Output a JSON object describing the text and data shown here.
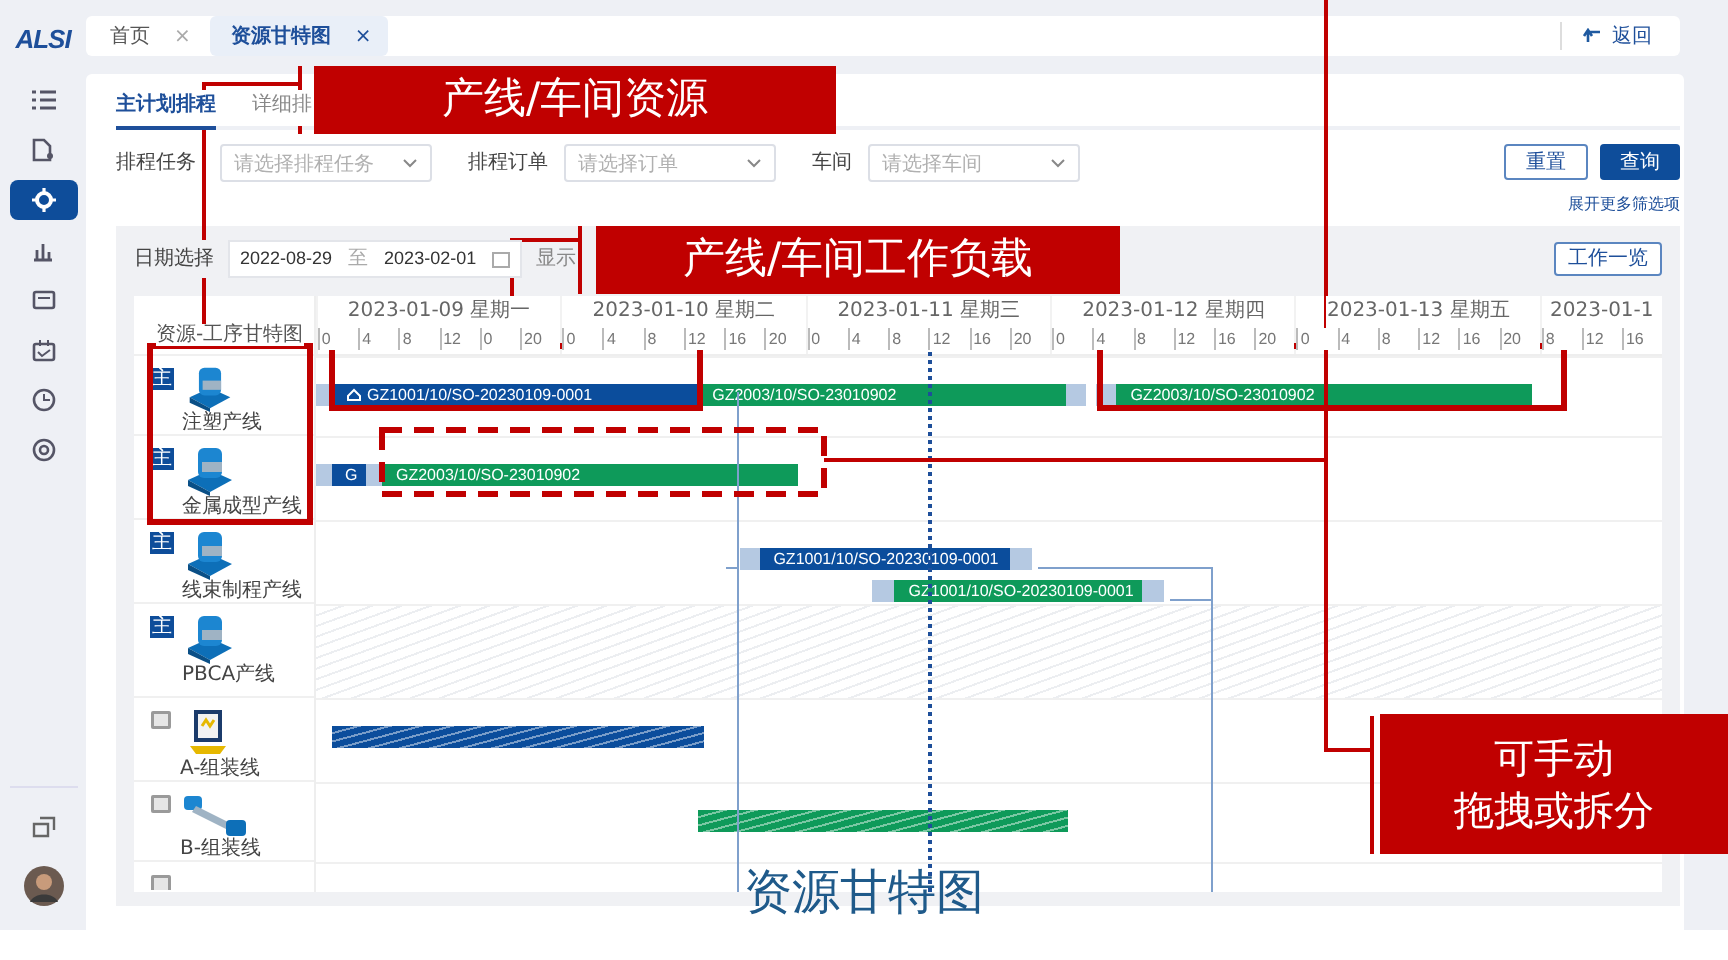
{
  "logo": "ALSI",
  "sidebar": {
    "items": [
      {
        "selected": false
      },
      {
        "selected": false
      },
      {
        "selected": true
      },
      {
        "selected": false
      },
      {
        "selected": false
      },
      {
        "selected": false
      },
      {
        "selected": false
      },
      {
        "selected": false
      }
    ]
  },
  "tabs": [
    {
      "label": "首页",
      "selected": false,
      "close": "×"
    },
    {
      "label": "资源甘特图",
      "selected": true,
      "close": "×"
    }
  ],
  "back": "返回",
  "subtabs": [
    {
      "label": "主计划排程",
      "selected": true
    },
    {
      "label": "详细排",
      "selected": false
    }
  ],
  "filters": [
    {
      "label": "排程任务",
      "placeholder": "请选择排程任务"
    },
    {
      "label": "排程订单",
      "placeholder": "请选择订单"
    },
    {
      "label": "车间",
      "placeholder": "请选择车间"
    }
  ],
  "buttons": [
    {
      "label": "重置",
      "kind": "secondary"
    },
    {
      "label": "查询",
      "kind": "primary"
    }
  ],
  "expand_link": "展开更多筛选项",
  "date_filter": {
    "label": "日期选择",
    "start": "2022-08-29",
    "separator": "至",
    "end": "2023-02-01",
    "display_label": "显示"
  },
  "work_list_button": "工作一览",
  "gantt": {
    "title": "资源-工序甘特图",
    "days": [
      {
        "label": "2023-01-09 星期一",
        "ticks": [
          "0",
          "4",
          "8",
          "12",
          "0",
          "20"
        ]
      },
      {
        "label": "2023-01-10 星期二",
        "ticks": [
          "0",
          "4",
          "8",
          "12",
          "16",
          "20"
        ]
      },
      {
        "label": "2023-01-11 星期三",
        "ticks": [
          "0",
          "4",
          "8",
          "12",
          "16",
          "20"
        ]
      },
      {
        "label": "2023-01-12 星期四",
        "ticks": [
          "0",
          "4",
          "8",
          "12",
          "16",
          "20"
        ]
      },
      {
        "label": "2023-01-13 星期五",
        "ticks": [
          "0",
          "4",
          "8",
          "12",
          "16",
          "20"
        ]
      },
      {
        "label": "2023-01-1",
        "ticks": [
          "8",
          "12",
          "16"
        ]
      }
    ],
    "resources": [
      {
        "name": "注塑产线",
        "kind": "main",
        "badge": "主",
        "unavailable": false,
        "bars": [
          {
            "kind": "setup",
            "color": "#b5c9e2"
          },
          {
            "kind": "task",
            "color": "#0b4d9c",
            "label": "GZ1001/10/SO-20230109-0001",
            "pinned": true
          },
          {
            "kind": "task",
            "color": "#0e9a5a",
            "label": "GZ2003/10/SO-23010902",
            "pinned": false
          },
          {
            "kind": "setup",
            "color": "#b5c9e2"
          },
          {
            "kind": "setup",
            "color": "#b5c9e2"
          },
          {
            "kind": "task",
            "color": "#0e9a5a",
            "label": "GZ2003/10/SO-23010902",
            "pinned": false
          }
        ]
      },
      {
        "name": "金属成型产线",
        "kind": "main",
        "badge": "主",
        "unavailable": false,
        "bars": [
          {
            "kind": "setup",
            "color": "#b5c9e2"
          },
          {
            "kind": "task",
            "color": "#0b4d9c",
            "label": "G",
            "pinned": false
          },
          {
            "kind": "setup",
            "color": "#b5c9e2"
          },
          {
            "kind": "task",
            "color": "#0e9a5a",
            "label": "GZ2003/10/SO-23010902",
            "pinned": false
          }
        ]
      },
      {
        "name": "线束制程产线",
        "kind": "main",
        "badge": "主",
        "unavailable": false,
        "bars": [
          {
            "kind": "setup",
            "color": "#b5c9e2"
          },
          {
            "kind": "task",
            "color": "#0b4d9c",
            "label": "GZ1001/10/SO-20230109-0001",
            "pinned": false
          },
          {
            "kind": "setup",
            "color": "#b5c9e2"
          },
          {
            "kind": "setup",
            "color": "#b5c9e2"
          },
          {
            "kind": "task",
            "color": "#0e9a5a",
            "label": "GZ1001/10/SO-20230109-0001",
            "pinned": false
          },
          {
            "kind": "setup",
            "color": "#b5c9e2"
          }
        ]
      },
      {
        "name": "PBCA产线",
        "kind": "main",
        "badge": "主",
        "unavailable": true
      },
      {
        "name": "A-组装线",
        "kind": "aux",
        "unavailable": false,
        "bars": [
          {
            "kind": "planned",
            "color": "#0b4d9c"
          }
        ]
      },
      {
        "name": "B-组装线",
        "kind": "aux",
        "unavailable": false,
        "bars": [
          {
            "kind": "planned",
            "color": "#0e9a5a"
          }
        ]
      },
      {
        "kind": "aux",
        "unavailable": false
      }
    ]
  },
  "annotations": [
    {
      "lines": [
        "产线/车间资源"
      ]
    },
    {
      "lines": [
        "产线/车间工作负载"
      ]
    },
    {
      "lines": [
        "可手动",
        "拖拽或拆分"
      ]
    }
  ],
  "caption": "资源甘特图"
}
